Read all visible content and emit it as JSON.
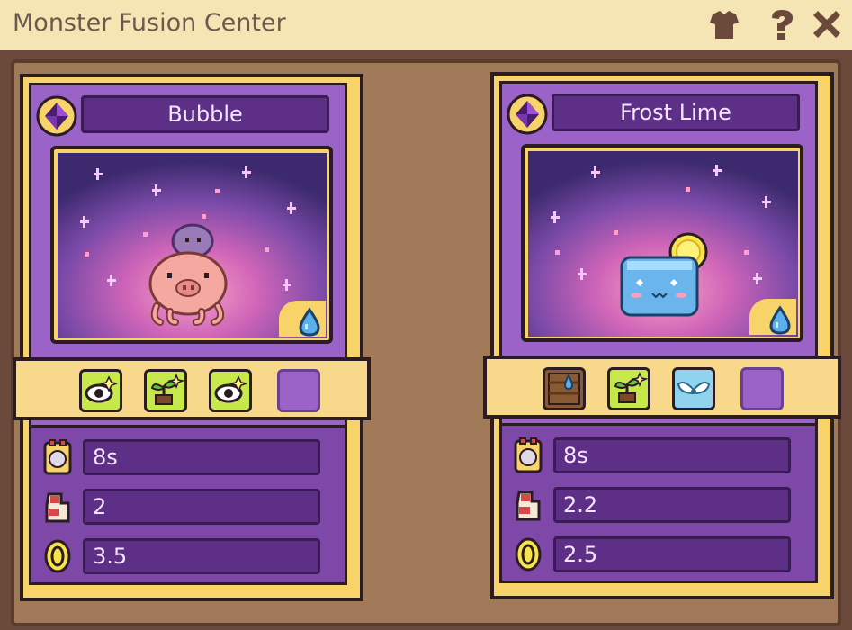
{
  "window": {
    "title": "Monster Fusion Center",
    "icons": [
      "shirt-icon",
      "help-icon",
      "close-icon"
    ]
  },
  "cards": [
    {
      "name": "Bubble",
      "element_icon": "water-drop-icon",
      "traits": [
        "eye-icon",
        "sprout-icon",
        "eye-icon",
        "empty-slot"
      ],
      "stats": [
        {
          "icon": "timer-icon",
          "value": "8s"
        },
        {
          "icon": "glove-icon",
          "value": "2"
        },
        {
          "icon": "coin-icon",
          "value": "3.5"
        }
      ]
    },
    {
      "name": "Frost Lime",
      "element_icon": "water-drop-icon",
      "traits": [
        "crate-icon",
        "sprout-icon",
        "wings-icon",
        "empty-slot"
      ],
      "stats": [
        {
          "icon": "timer-icon",
          "value": "8s"
        },
        {
          "icon": "glove-icon",
          "value": "2.2"
        },
        {
          "icon": "coin-icon",
          "value": "2.5"
        }
      ]
    }
  ],
  "colors": {
    "card_purple": "#9b63c7",
    "plate_purple": "#5e2f86",
    "gold": "#f7d36a",
    "panel_brown": "#a07a58"
  }
}
